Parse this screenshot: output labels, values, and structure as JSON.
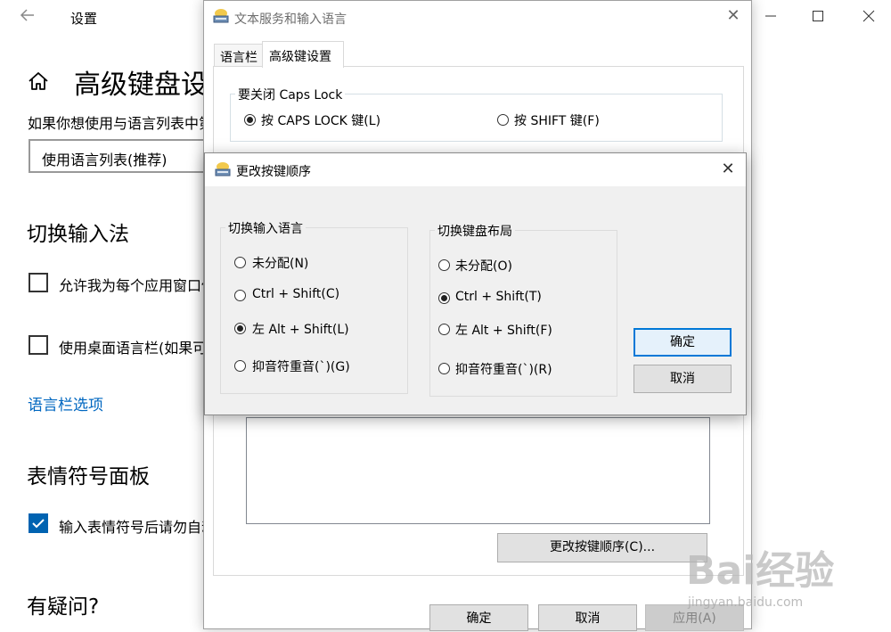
{
  "settings": {
    "app_title": "设置",
    "page_title": "高级键盘设置",
    "description": "如果你想使用与语言列表中第一种语言不同的默认输入法",
    "combo_value": "使用语言列表(推荐)",
    "switch_section": "切换输入法",
    "checkbox1_label": "允许我为每个应用窗口使用不同的输入法",
    "checkbox2_label": "使用桌面语言栏(如果可用)",
    "langbar_link": "语言栏选项",
    "emoji_section": "表情符号面板",
    "checkbox3_label": "输入表情符号后请勿自动关闭面板",
    "help_section": "有疑问?"
  },
  "text_services_dialog": {
    "title": "文本服务和输入语言",
    "tabs": [
      "语言栏",
      "高级键设置"
    ],
    "caps_group_title": "要关闭 Caps Lock",
    "caps_option1": "按 CAPS LOCK 键(L)",
    "caps_option2": "按 SHIFT 键(F)",
    "caps_selected": "按 CAPS LOCK 键(L)",
    "change_sequence_button": "更改按键顺序(C)...",
    "ok_button": "确定",
    "cancel_button": "取消",
    "apply_button": "应用(A)"
  },
  "key_sequence_dialog": {
    "title": "更改按键顺序",
    "input_language_group": {
      "title": "切换输入语言",
      "options": [
        "未分配(N)",
        "Ctrl + Shift(C)",
        "左 Alt + Shift(L)",
        "抑音符重音(`)(G)"
      ],
      "selected": "左 Alt + Shift(L)"
    },
    "keyboard_layout_group": {
      "title": "切换键盘布局",
      "options": [
        "未分配(O)",
        "Ctrl + Shift(T)",
        "左 Alt + Shift(F)",
        "抑音符重音(`)(R)"
      ],
      "selected": "Ctrl + Shift(T)"
    },
    "ok_button": "确定",
    "cancel_button": "取消"
  },
  "watermark": {
    "brand": "Bai经验",
    "url": "jingyan.baidu.com"
  },
  "colors": {
    "accent": "#0063b1",
    "link": "#0067c0",
    "dialog_bg": "#f0f0f0",
    "primary_border": "#0078d7"
  },
  "icons": [
    "back-arrow-icon",
    "home-icon",
    "minimize-icon",
    "maximize-icon",
    "close-icon",
    "keyboard-icon",
    "checkmark-icon"
  ]
}
